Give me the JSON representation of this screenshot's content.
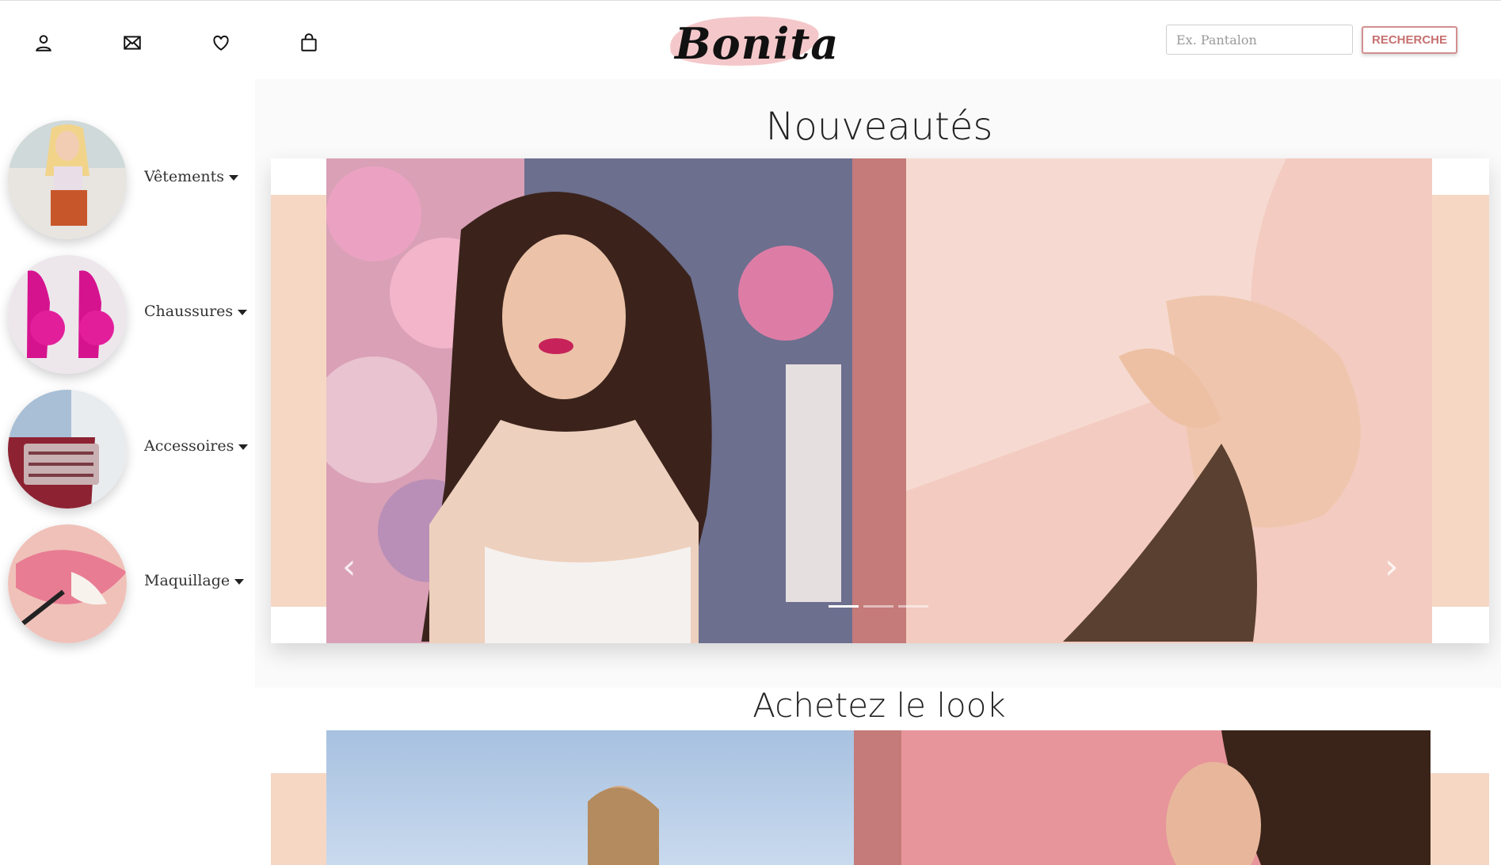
{
  "brand": {
    "logo_text": "Bonita"
  },
  "header": {
    "icons": [
      "user-icon",
      "mail-icon",
      "heart-icon",
      "bag-icon"
    ],
    "search": {
      "placeholder": "Ex. Pantalon",
      "button_label": "RECHERCHE"
    }
  },
  "sidebar": {
    "items": [
      {
        "label": "Vêtements"
      },
      {
        "label": "Chaussures"
      },
      {
        "label": "Accessoires"
      },
      {
        "label": "Maquillage"
      }
    ]
  },
  "sections": {
    "new_title": "Nouveautés",
    "look_title": "Achetez le look"
  },
  "carousel": {
    "slide_count": 3,
    "active_index": 0
  },
  "colors": {
    "accent": "#c47b79",
    "peach": "#f6d7c4",
    "button": "#d38f8f"
  }
}
